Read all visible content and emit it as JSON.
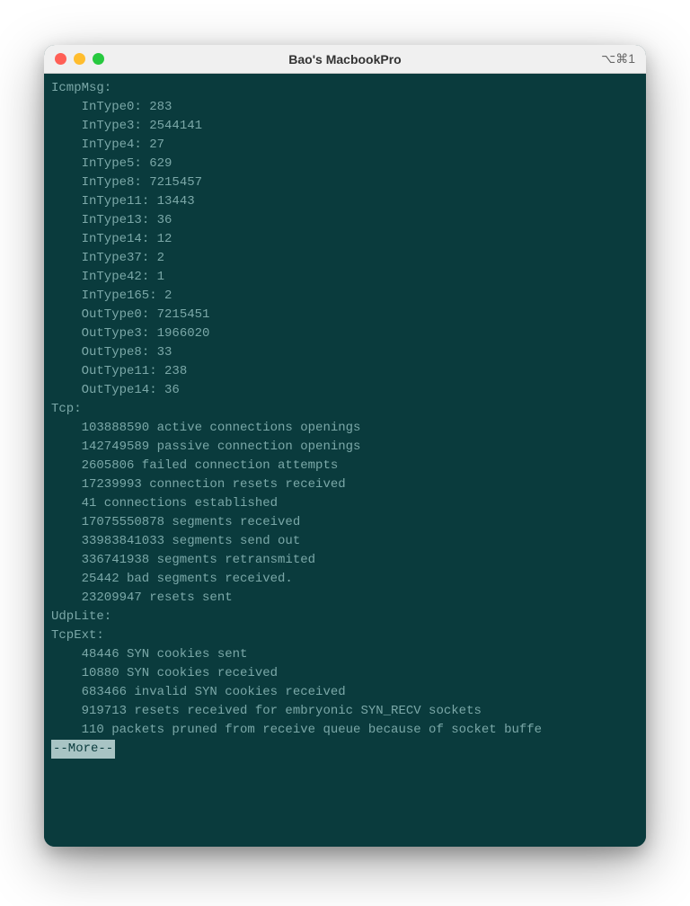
{
  "window": {
    "title": "Bao's MacbookPro",
    "shortcut": "⌥⌘1"
  },
  "sections": {
    "icmpMsg": {
      "label": "IcmpMsg:",
      "entries": [
        {
          "key": "InType0",
          "value": "283"
        },
        {
          "key": "InType3",
          "value": "2544141"
        },
        {
          "key": "InType4",
          "value": "27"
        },
        {
          "key": "InType5",
          "value": "629"
        },
        {
          "key": "InType8",
          "value": "7215457"
        },
        {
          "key": "InType11",
          "value": "13443"
        },
        {
          "key": "InType13",
          "value": "36"
        },
        {
          "key": "InType14",
          "value": "12"
        },
        {
          "key": "InType37",
          "value": "2"
        },
        {
          "key": "InType42",
          "value": "1"
        },
        {
          "key": "InType165",
          "value": "2"
        },
        {
          "key": "OutType0",
          "value": "7215451"
        },
        {
          "key": "OutType3",
          "value": "1966020"
        },
        {
          "key": "OutType8",
          "value": "33"
        },
        {
          "key": "OutType11",
          "value": "238"
        },
        {
          "key": "OutType14",
          "value": "36"
        }
      ]
    },
    "tcp": {
      "label": "Tcp:",
      "lines": [
        "103888590 active connections openings",
        "142749589 passive connection openings",
        "2605806 failed connection attempts",
        "17239993 connection resets received",
        "41 connections established",
        "17075550878 segments received",
        "33983841033 segments send out",
        "336741938 segments retransmited",
        "25442 bad segments received.",
        "23209947 resets sent"
      ]
    },
    "udpLite": {
      "label": "UdpLite:"
    },
    "tcpExt": {
      "label": "TcpExt:",
      "lines": [
        "48446 SYN cookies sent",
        "10880 SYN cookies received",
        "683466 invalid SYN cookies received",
        "919713 resets received for embryonic SYN_RECV sockets",
        "110 packets pruned from receive queue because of socket buffe"
      ]
    }
  },
  "pager": {
    "more": "--More--"
  }
}
